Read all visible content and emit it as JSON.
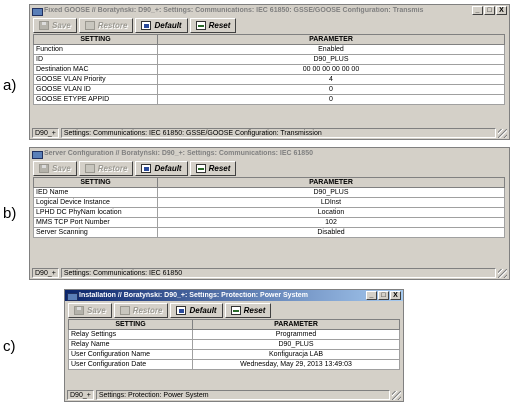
{
  "labels": {
    "a": "a)",
    "b": "b)",
    "c": "c)"
  },
  "window_controls": {
    "minimize": "_",
    "maximize": "□",
    "close": "X"
  },
  "toolbar": {
    "save": "Save",
    "restore": "Restore",
    "default": "Default",
    "reset": "Reset"
  },
  "columns": {
    "setting": "SETTING",
    "parameter": "PARAMETER"
  },
  "windows": [
    {
      "title": "Fixed GOOSE // Boratyński: D90_+: Settings: Communications: IEC 61850: GSSE/GOOSE Configuration: Transmis",
      "rows": [
        {
          "setting": "Function",
          "parameter": "Enabled"
        },
        {
          "setting": "ID",
          "parameter": "D90_PLUS"
        },
        {
          "setting": "Destination MAC",
          "parameter": "00 00 00 00 00 00"
        },
        {
          "setting": "GOOSE VLAN Priority",
          "parameter": "4"
        },
        {
          "setting": "GOOSE VLAN ID",
          "parameter": "0"
        },
        {
          "setting": "GOOSE ETYPE APPID",
          "parameter": "0"
        }
      ],
      "status": {
        "device": "D90_+",
        "path": "Settings: Communications: IEC 61850: GSSE/GOOSE Configuration: Transmission"
      }
    },
    {
      "title": "Server Configuration // Boratyński: D90_+: Settings: Communications: IEC 61850",
      "rows": [
        {
          "setting": "IED Name",
          "parameter": "D90_PLUS"
        },
        {
          "setting": "Logical Device Instance",
          "parameter": "LDInst"
        },
        {
          "setting": "LPHD DC PhyNam location",
          "parameter": "Location"
        },
        {
          "setting": "MMS TCP Port Number",
          "parameter": "102"
        },
        {
          "setting": "Server Scanning",
          "parameter": "Disabled"
        }
      ],
      "status": {
        "device": "D90_+",
        "path": "Settings: Communications: IEC 61850"
      }
    },
    {
      "title": "Installation // Boratyński: D90_+: Settings: Protection: Power System",
      "rows": [
        {
          "setting": "Relay Settings",
          "parameter": "Programmed"
        },
        {
          "setting": "Relay Name",
          "parameter": "D90_PLUS"
        },
        {
          "setting": "User Configuration Name",
          "parameter": "Konfiguracja LAB"
        },
        {
          "setting": "User Configuration Date",
          "parameter": "Wednesday, May 29, 2013 13:49:03"
        }
      ],
      "status": {
        "device": "D90_+",
        "path": "Settings: Protection: Power System"
      }
    }
  ]
}
